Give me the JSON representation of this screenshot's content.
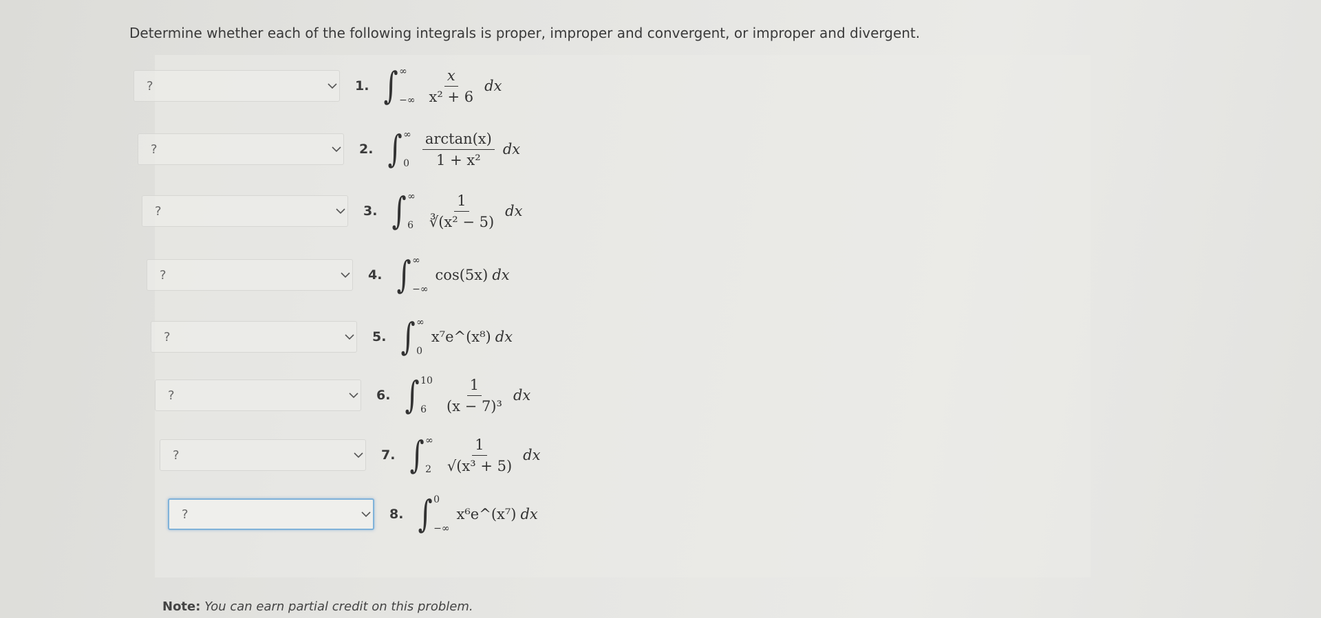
{
  "instructions": "Determine whether each of the following integrals is proper, improper and convergent, or improper and divergent.",
  "dropdown_value": "?",
  "items": [
    {
      "num": "1.",
      "lower": "−∞",
      "upper": "∞",
      "numerator": "x",
      "denominator": "x² + 6",
      "dx": "dx"
    },
    {
      "num": "2.",
      "lower": "0",
      "upper": "∞",
      "numerator": "arctan(x)",
      "denominator": "1 + x²",
      "dx": "dx"
    },
    {
      "num": "3.",
      "lower": "6",
      "upper": "∞",
      "numerator": "1",
      "denominator": "∛(x² − 5)",
      "dx": "dx"
    },
    {
      "num": "4.",
      "lower": "−∞",
      "upper": "∞",
      "integrand": "cos(5x)",
      "dx": "dx"
    },
    {
      "num": "5.",
      "lower": "0",
      "upper": "∞",
      "integrand": "x⁷e^(x⁸)",
      "dx": "dx"
    },
    {
      "num": "6.",
      "lower": "6",
      "upper": "10",
      "numerator": "1",
      "denominator": "(x − 7)³",
      "dx": "dx"
    },
    {
      "num": "7.",
      "lower": "2",
      "upper": "∞",
      "numerator": "1",
      "denominator": "√(x³ + 5)",
      "dx": "dx"
    },
    {
      "num": "8.",
      "lower": "−∞",
      "upper": "0",
      "integrand": "x⁶e^(x⁷)",
      "dx": "dx"
    }
  ],
  "note": {
    "label": "Note:",
    "text": "You can earn partial credit on this problem."
  }
}
